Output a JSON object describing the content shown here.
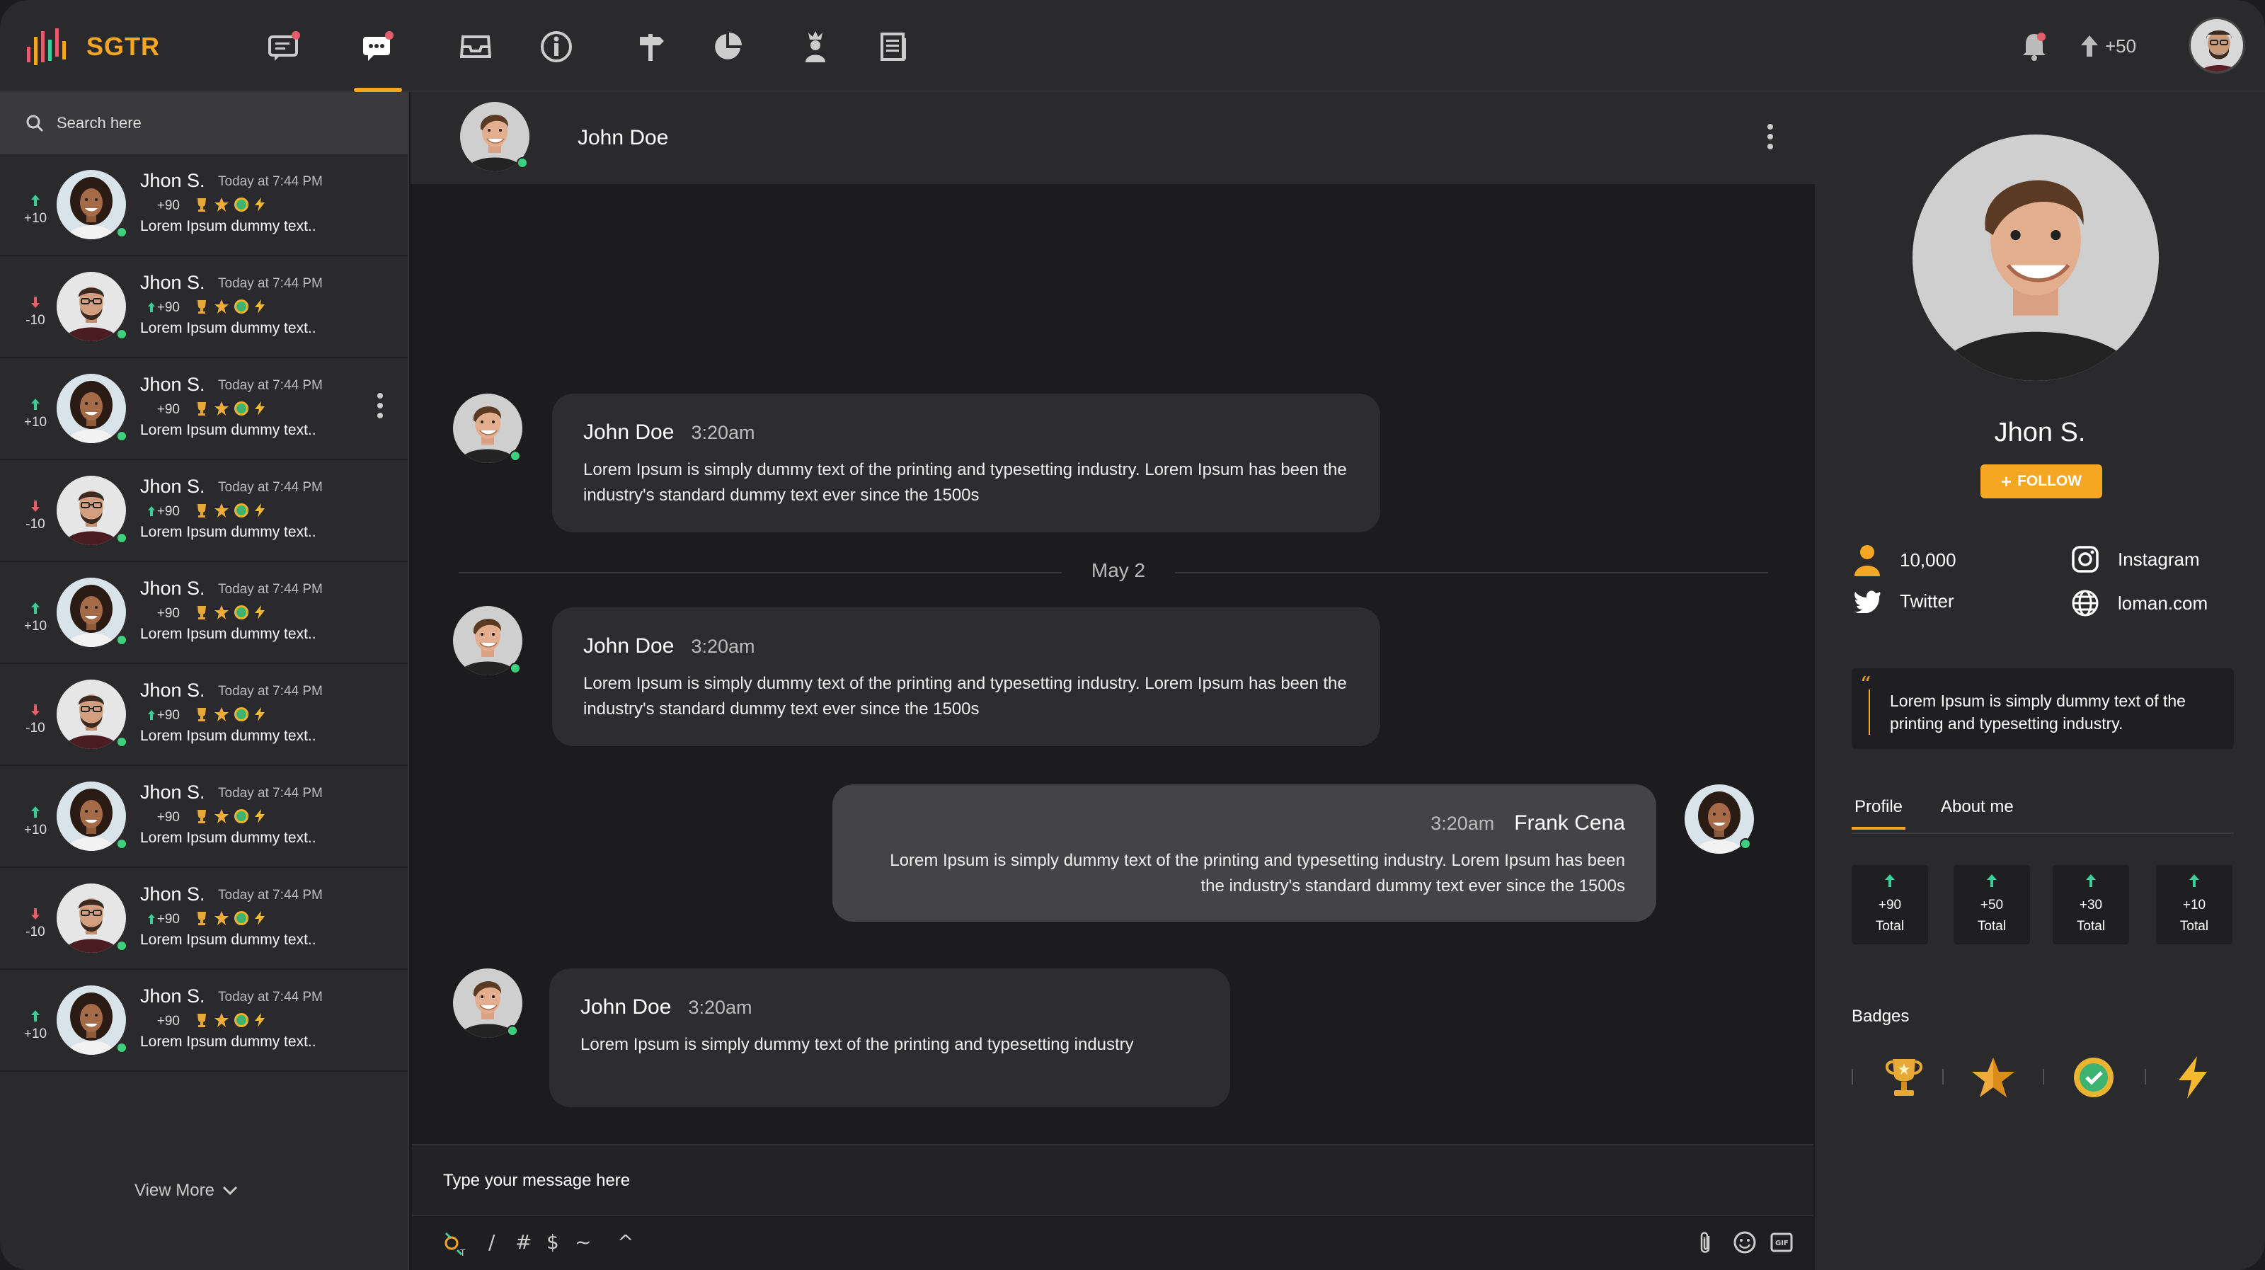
{
  "app": {
    "logo_text": "SGTR"
  },
  "topbar": {
    "nav_icons": [
      "chat-bubbles-icon",
      "messages-icon",
      "inbox-icon",
      "info-icon",
      "signpost-icon",
      "pie-chart-icon",
      "leaderboard-icon",
      "news-icon"
    ],
    "active_nav": "messages-icon",
    "points_label": "+50"
  },
  "sidebar": {
    "search_placeholder": "Search here",
    "contacts": [
      {
        "delta": "+10",
        "trend": "up",
        "name": "Jhon S.",
        "time": "Today at 7:44 PM",
        "points": "+90",
        "points_arrow": false,
        "text": "Lorem Ipsum dummy text..",
        "avatar": "woman"
      },
      {
        "delta": "-10",
        "trend": "down",
        "name": "Jhon S.",
        "time": "Today at 7:44 PM",
        "points": "+90",
        "points_arrow": true,
        "text": "Lorem Ipsum dummy text..",
        "avatar": "man"
      },
      {
        "delta": "+10",
        "trend": "up",
        "name": "Jhon S.",
        "time": "Today at 7:44 PM",
        "points": "+90",
        "points_arrow": false,
        "text": "Lorem Ipsum dummy text..",
        "avatar": "woman"
      },
      {
        "delta": "-10",
        "trend": "down",
        "name": "Jhon S.",
        "time": "Today at 7:44 PM",
        "points": "+90",
        "points_arrow": true,
        "text": "Lorem Ipsum dummy text..",
        "avatar": "man"
      },
      {
        "delta": "+10",
        "trend": "up",
        "name": "Jhon S.",
        "time": "Today at 7:44 PM",
        "points": "+90",
        "points_arrow": false,
        "text": "Lorem Ipsum dummy text..",
        "avatar": "woman"
      },
      {
        "delta": "-10",
        "trend": "down",
        "name": "Jhon S.",
        "time": "Today at 7:44 PM",
        "points": "+90",
        "points_arrow": true,
        "text": "Lorem Ipsum dummy text..",
        "avatar": "man"
      },
      {
        "delta": "+10",
        "trend": "up",
        "name": "Jhon S.",
        "time": "Today at 7:44 PM",
        "points": "+90",
        "points_arrow": false,
        "text": "Lorem Ipsum dummy text..",
        "avatar": "woman"
      },
      {
        "delta": "-10",
        "trend": "down",
        "name": "Jhon S.",
        "time": "Today at 7:44 PM",
        "points": "+90",
        "points_arrow": true,
        "text": "Lorem Ipsum dummy text..",
        "avatar": "man"
      },
      {
        "delta": "+10",
        "trend": "up",
        "name": "Jhon S.",
        "time": "Today at 7:44 PM",
        "points": "+90",
        "points_arrow": false,
        "text": "Lorem Ipsum dummy text..",
        "avatar": "woman"
      }
    ],
    "view_more": "View More"
  },
  "chat": {
    "header_name": "John Doe",
    "date_divider": "May 2",
    "messages": [
      {
        "sender": "John Doe",
        "time": "3:20am",
        "text": "Lorem Ipsum is simply dummy text of the printing and typesetting industry. Lorem Ipsum has been the industry's standard dummy text ever since the 1500s"
      },
      {
        "sender": "John Doe",
        "time": "3:20am",
        "text": "Lorem Ipsum is simply dummy text of the printing and typesetting industry. Lorem Ipsum has been the industry's standard dummy text ever since the 1500s"
      },
      {
        "sender": "Frank Cena",
        "time": "3:20am",
        "text": "Lorem Ipsum is simply dummy text of the printing and typesetting industry. Lorem Ipsum has been the industry's standard dummy text ever since the 1500s"
      },
      {
        "sender": "John Doe",
        "time": "3:20am",
        "text": "Lorem Ipsum is simply dummy text of the printing and typesetting industry"
      }
    ],
    "composer_placeholder": "Type your message here",
    "tools": {
      "slash": "/",
      "hash": "#",
      "dollar": "$",
      "tilde": "~",
      "caret": "^"
    }
  },
  "profile": {
    "name": "Jhon S.",
    "follow_label": "FOLLOW",
    "followers": "10,000",
    "instagram": "Instagram",
    "twitter": "Twitter",
    "website": "loman.com",
    "quote": "Lorem Ipsum is simply dummy text of the printing and typesetting industry.",
    "tabs": [
      "Profile",
      "About me"
    ],
    "stats": [
      {
        "value": "+90",
        "label": "Total"
      },
      {
        "value": "+50",
        "label": "Total"
      },
      {
        "value": "+30",
        "label": "Total"
      },
      {
        "value": "+10",
        "label": "Total"
      }
    ],
    "badges_title": "Badges",
    "badges": [
      "trophy-icon",
      "star-icon",
      "verified-icon",
      "lightning-icon"
    ]
  },
  "colors": {
    "accent": "#f5a623",
    "up": "#3ccf9a",
    "down": "#e35d6a",
    "online": "#3ccf7e"
  }
}
